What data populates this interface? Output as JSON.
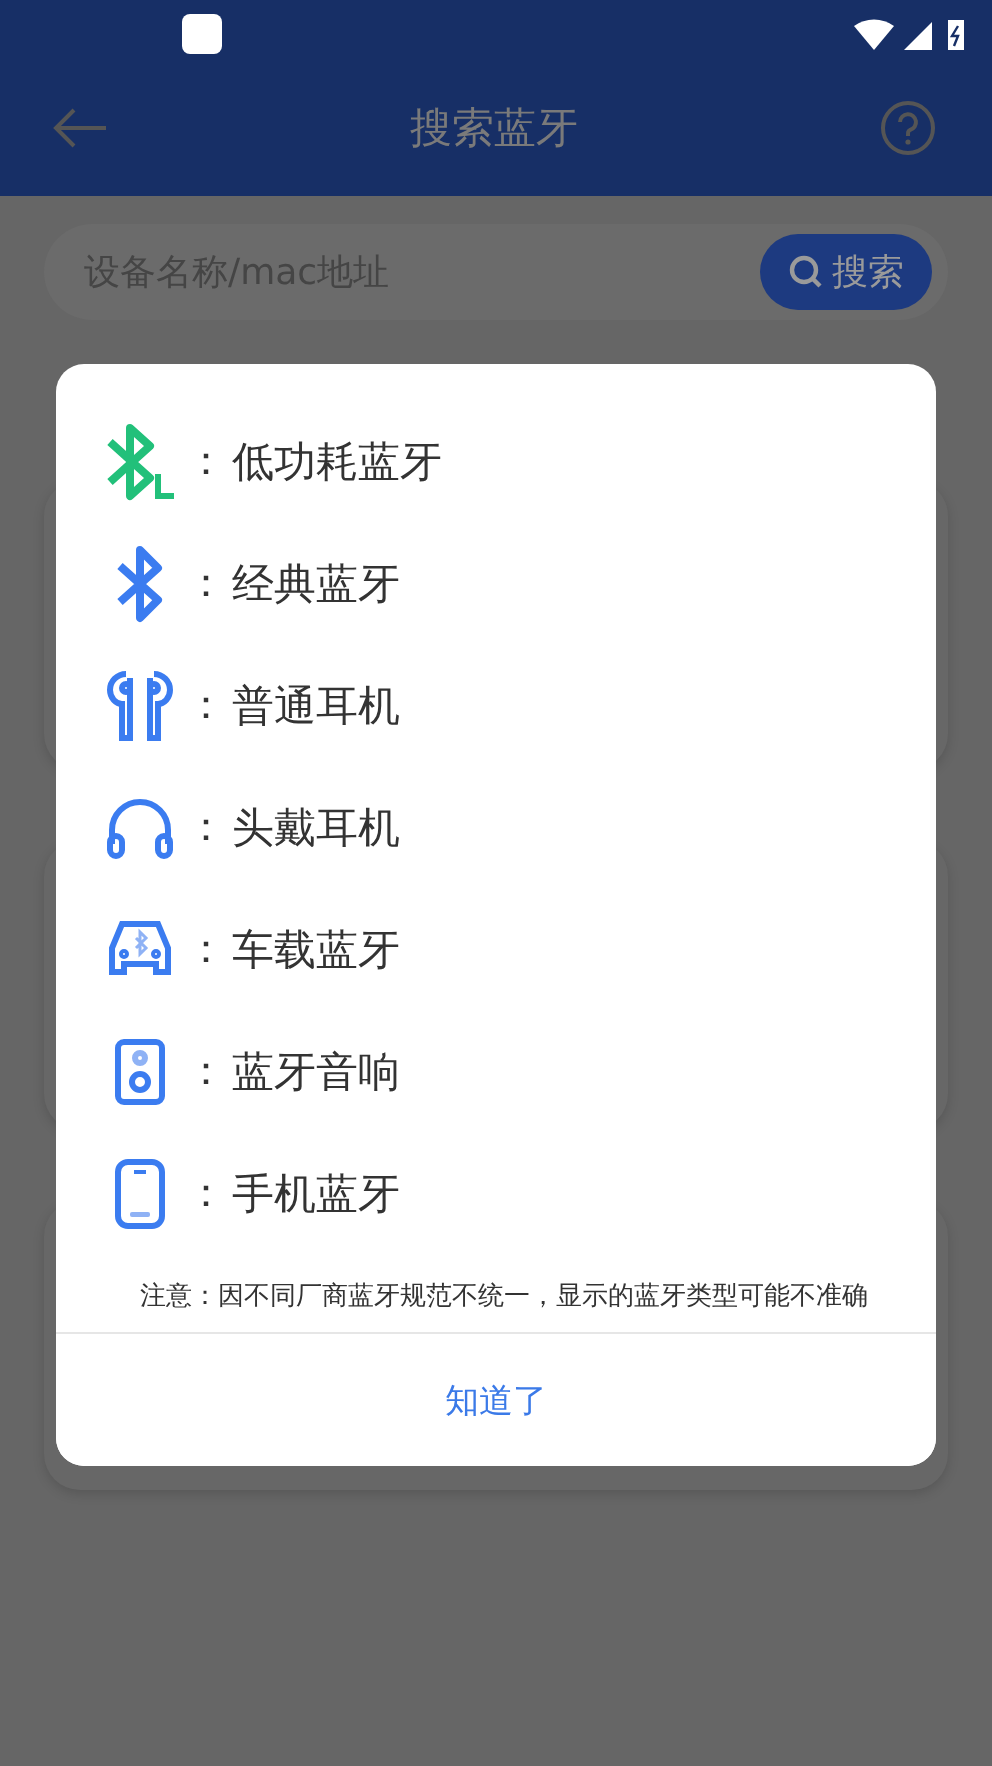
{
  "app_bar": {
    "title": "搜索蓝牙"
  },
  "search": {
    "placeholder": "设备名称/mac地址",
    "button": "搜索"
  },
  "cards": [
    {
      "kind": "card"
    },
    {
      "kind": "card"
    },
    {
      "kind": "card"
    }
  ],
  "dialog": {
    "items": [
      {
        "kind": "ble",
        "separator": "：",
        "label": "低功耗蓝牙"
      },
      {
        "kind": "classic",
        "separator": "：",
        "label": "经典蓝牙"
      },
      {
        "kind": "earbuds",
        "separator": "：",
        "label": "普通耳机"
      },
      {
        "kind": "headset",
        "separator": "：",
        "label": "头戴耳机"
      },
      {
        "kind": "car",
        "separator": "：",
        "label": "车载蓝牙"
      },
      {
        "kind": "speaker",
        "separator": "：",
        "label": "蓝牙音响"
      },
      {
        "kind": "phone",
        "separator": "：",
        "label": "手机蓝牙"
      }
    ],
    "note": "注意：因不同厂商蓝牙规范不统一，显示的蓝牙类型可能不准确",
    "button": "知道了"
  }
}
